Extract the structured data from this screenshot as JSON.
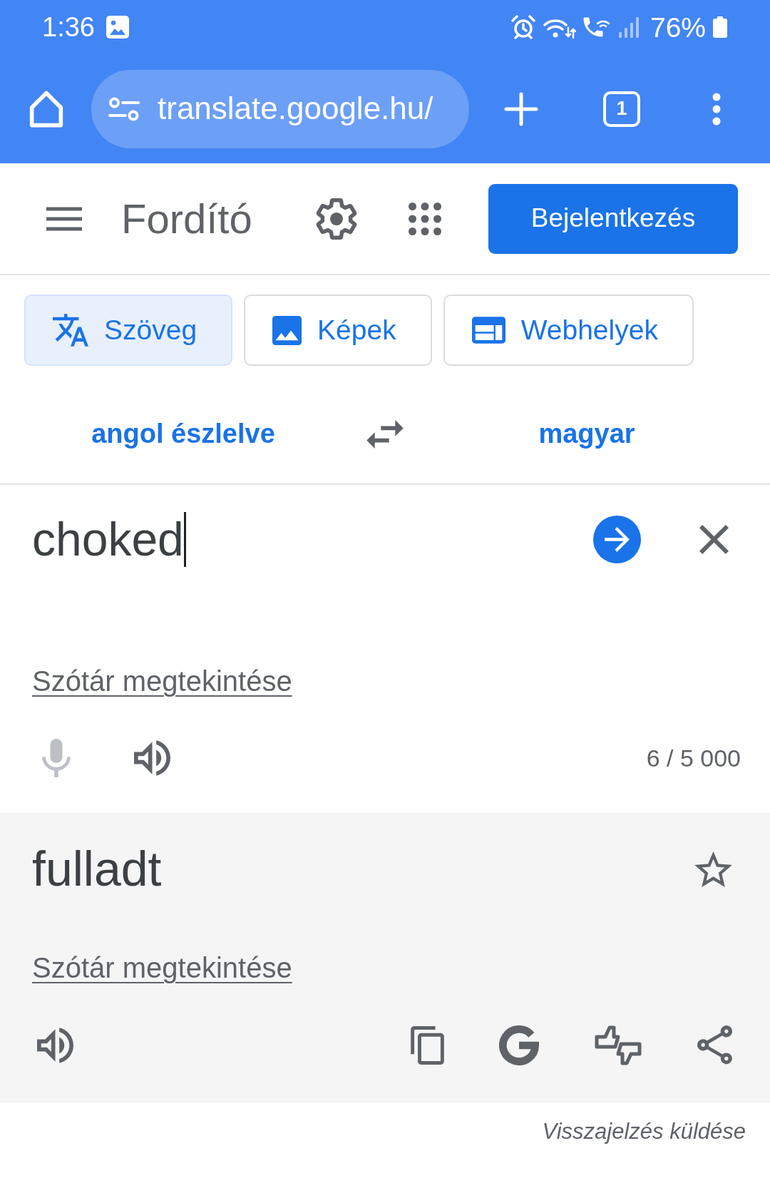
{
  "status_bar": {
    "time": "1:36",
    "battery": "76%"
  },
  "browser": {
    "url": "translate.google.hu/",
    "tab_count": "1"
  },
  "header": {
    "title": "Fordító",
    "sign_in_button": "Bejelentkezés"
  },
  "modes": [
    {
      "kind": "text",
      "label": "Szöveg",
      "selected": true
    },
    {
      "kind": "images",
      "label": "Képek",
      "selected": false
    },
    {
      "kind": "websites",
      "label": "Webhelyek",
      "selected": false
    }
  ],
  "languages": {
    "source": "angol észlelve",
    "target": "magyar"
  },
  "source": {
    "value": "choked",
    "focused": true,
    "dictionary_link": "Szótár megtekintése",
    "mic": {
      "disabled": true
    },
    "counter": "6 / 5 000"
  },
  "translation": {
    "text": "fulladt",
    "starred": false,
    "dictionary_link": "Szótár megtekintése"
  },
  "feedback_link": "Visszajelzés küldése"
}
